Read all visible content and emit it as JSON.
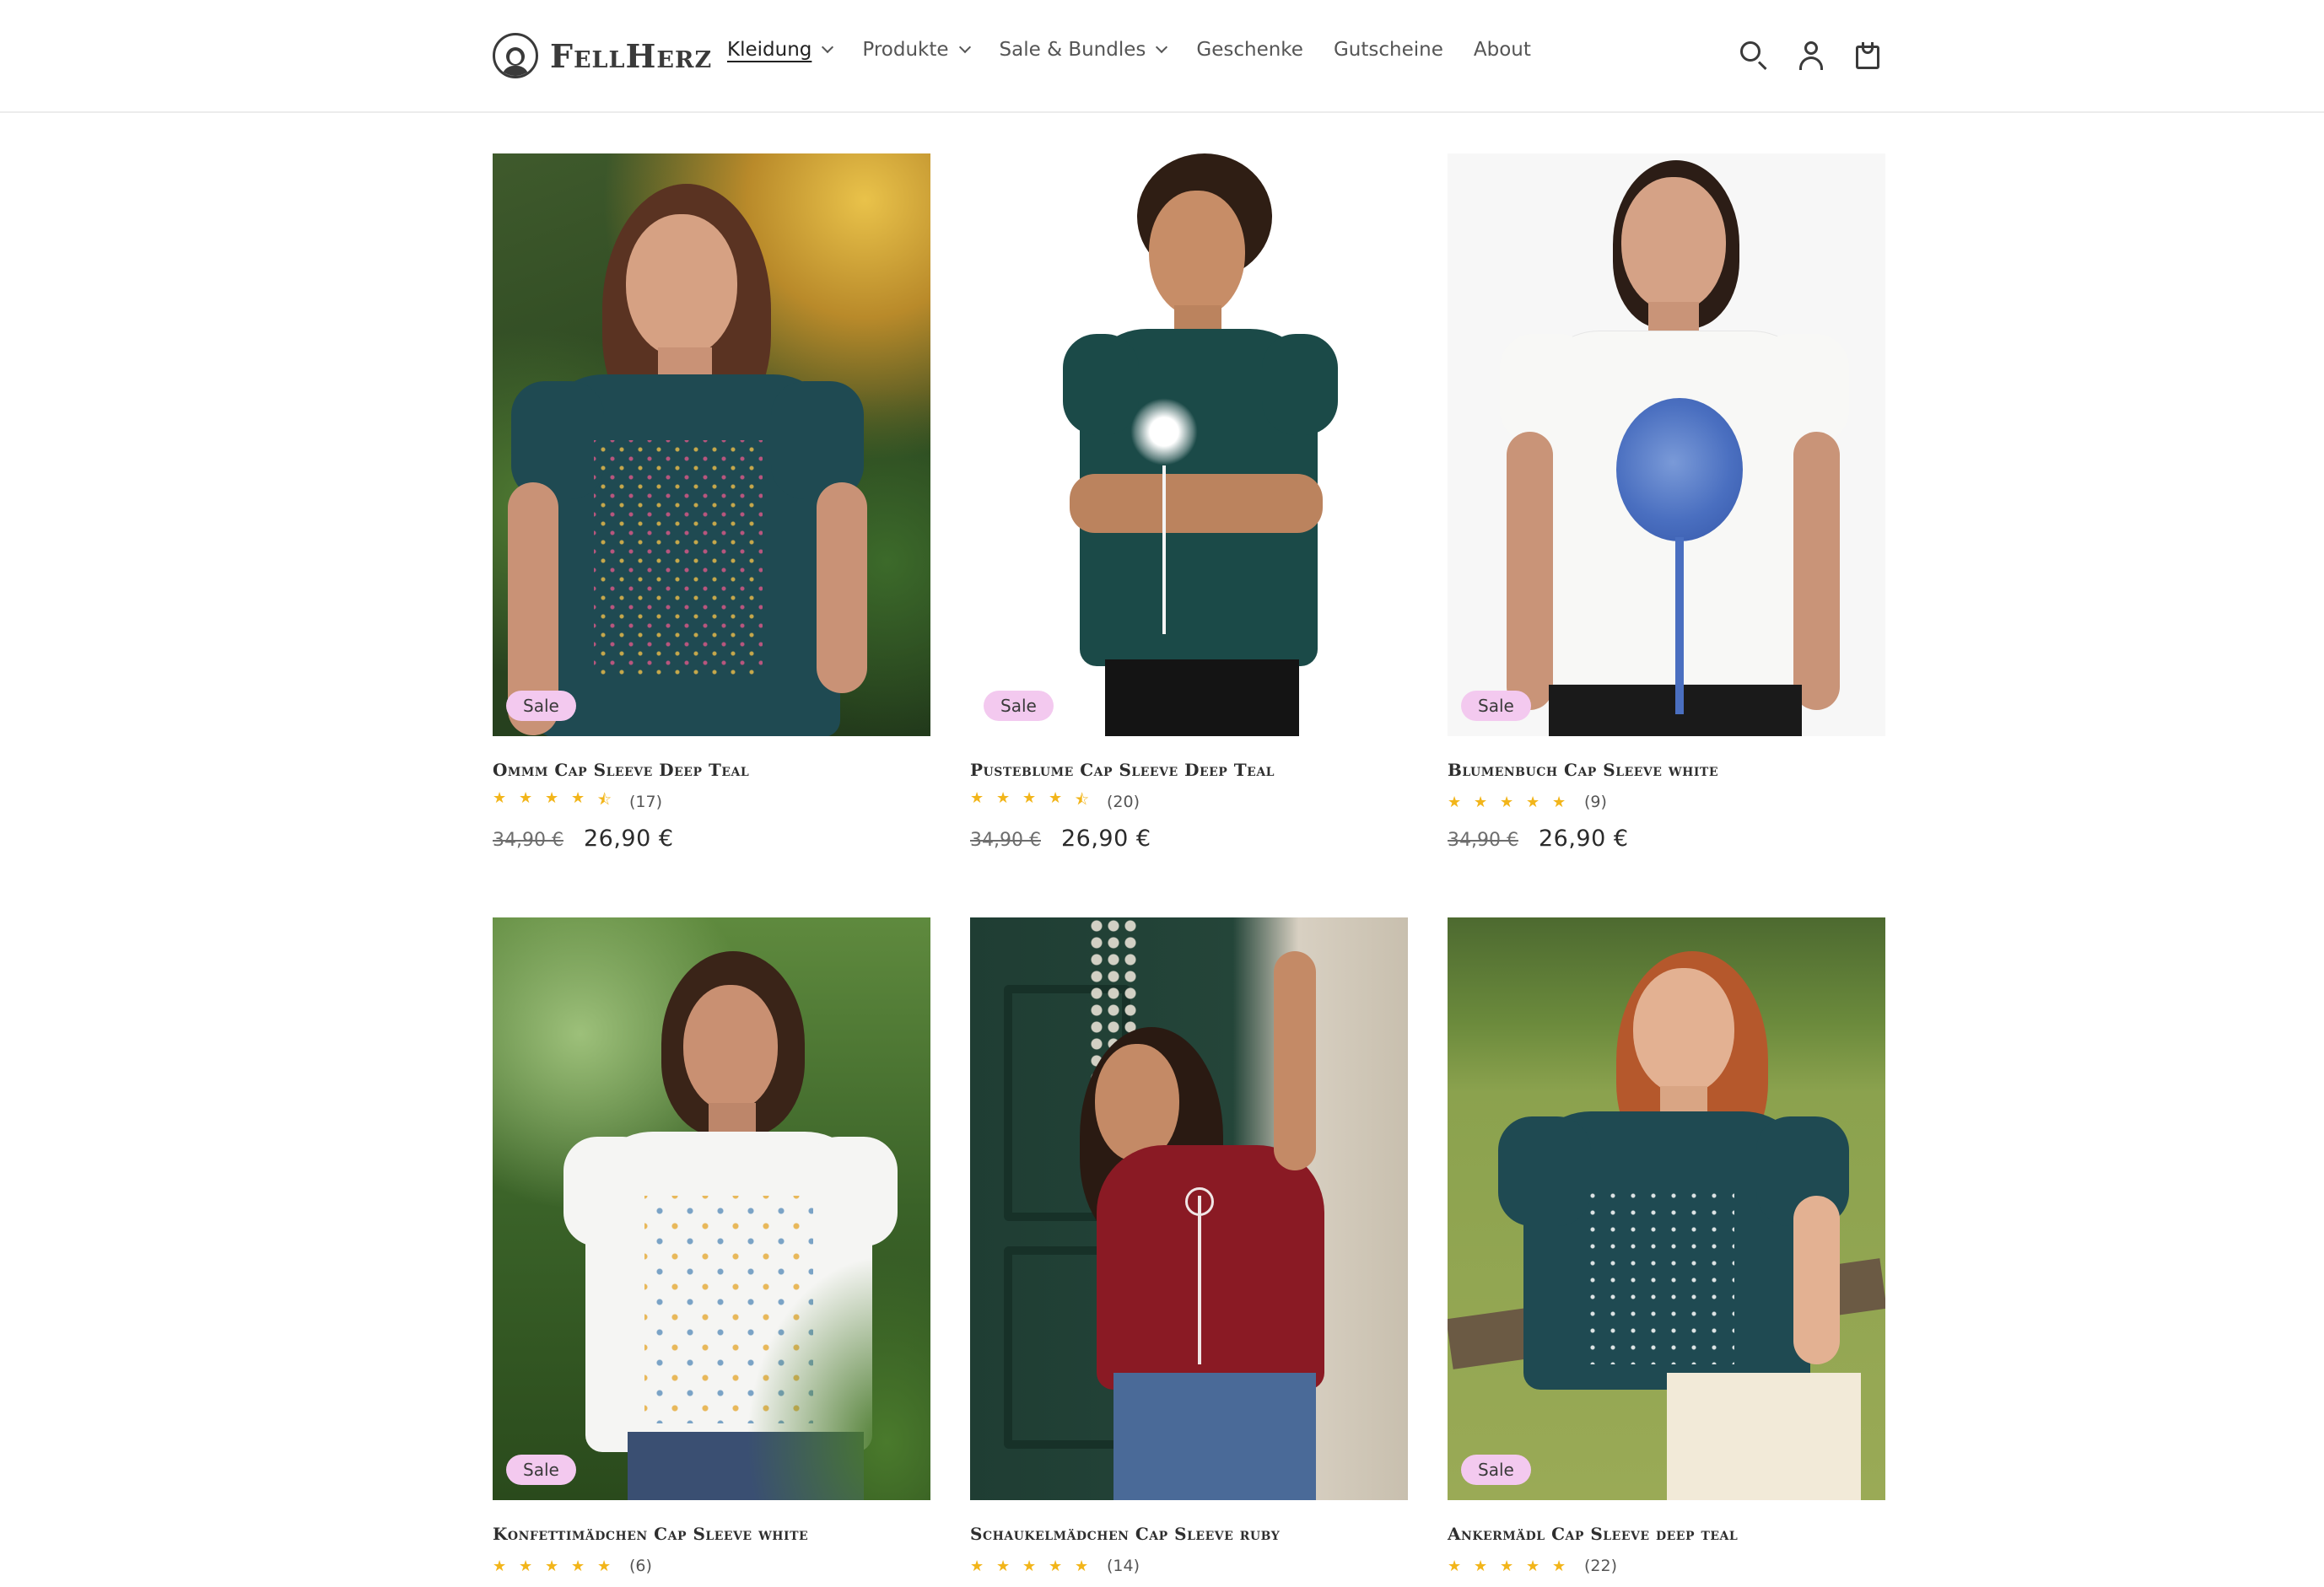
{
  "brand": {
    "name": "FellHerz"
  },
  "nav": {
    "items": [
      {
        "label": "Kleidung",
        "has_dropdown": true,
        "active": true
      },
      {
        "label": "Produkte",
        "has_dropdown": true,
        "active": false
      },
      {
        "label": "Sale & Bundles",
        "has_dropdown": true,
        "active": false
      },
      {
        "label": "Geschenke",
        "has_dropdown": false,
        "active": false
      },
      {
        "label": "Gutscheine",
        "has_dropdown": false,
        "active": false
      },
      {
        "label": "About",
        "has_dropdown": false,
        "active": false
      }
    ]
  },
  "header_icons": [
    "search-icon",
    "account-icon",
    "cart-icon"
  ],
  "colors": {
    "badge_bg": "#f3c9ef",
    "star": "#f2b51a",
    "deep_teal": "#1f4a52",
    "ruby": "#8a1a24",
    "white": "#f4f4f2"
  },
  "products": [
    {
      "title": "Ommm Cap Sleeve Deep Teal",
      "badge": "Sale",
      "rating": 4.5,
      "reviews": "(17)",
      "old_price": "34,90 €",
      "price": "26,90 €"
    },
    {
      "title": "Pusteblume Cap Sleeve Deep Teal",
      "badge": "Sale",
      "rating": 4.5,
      "reviews": "(20)",
      "old_price": "34,90 €",
      "price": "26,90 €"
    },
    {
      "title": "Blumenbuch Cap Sleeve white",
      "badge": "Sale",
      "rating": 5,
      "reviews": "(9)",
      "old_price": "34,90 €",
      "price": "26,90 €"
    },
    {
      "title": "Konfettimädchen Cap Sleeve white",
      "badge": "Sale",
      "rating": 5,
      "reviews": "(6)"
    },
    {
      "title": "Schaukelmädchen Cap Sleeve ruby",
      "badge": "",
      "rating": 5,
      "reviews": "(14)"
    },
    {
      "title": "Ankermädl Cap Sleeve deep teal",
      "badge": "Sale",
      "rating": 5,
      "reviews": "(22)"
    }
  ]
}
